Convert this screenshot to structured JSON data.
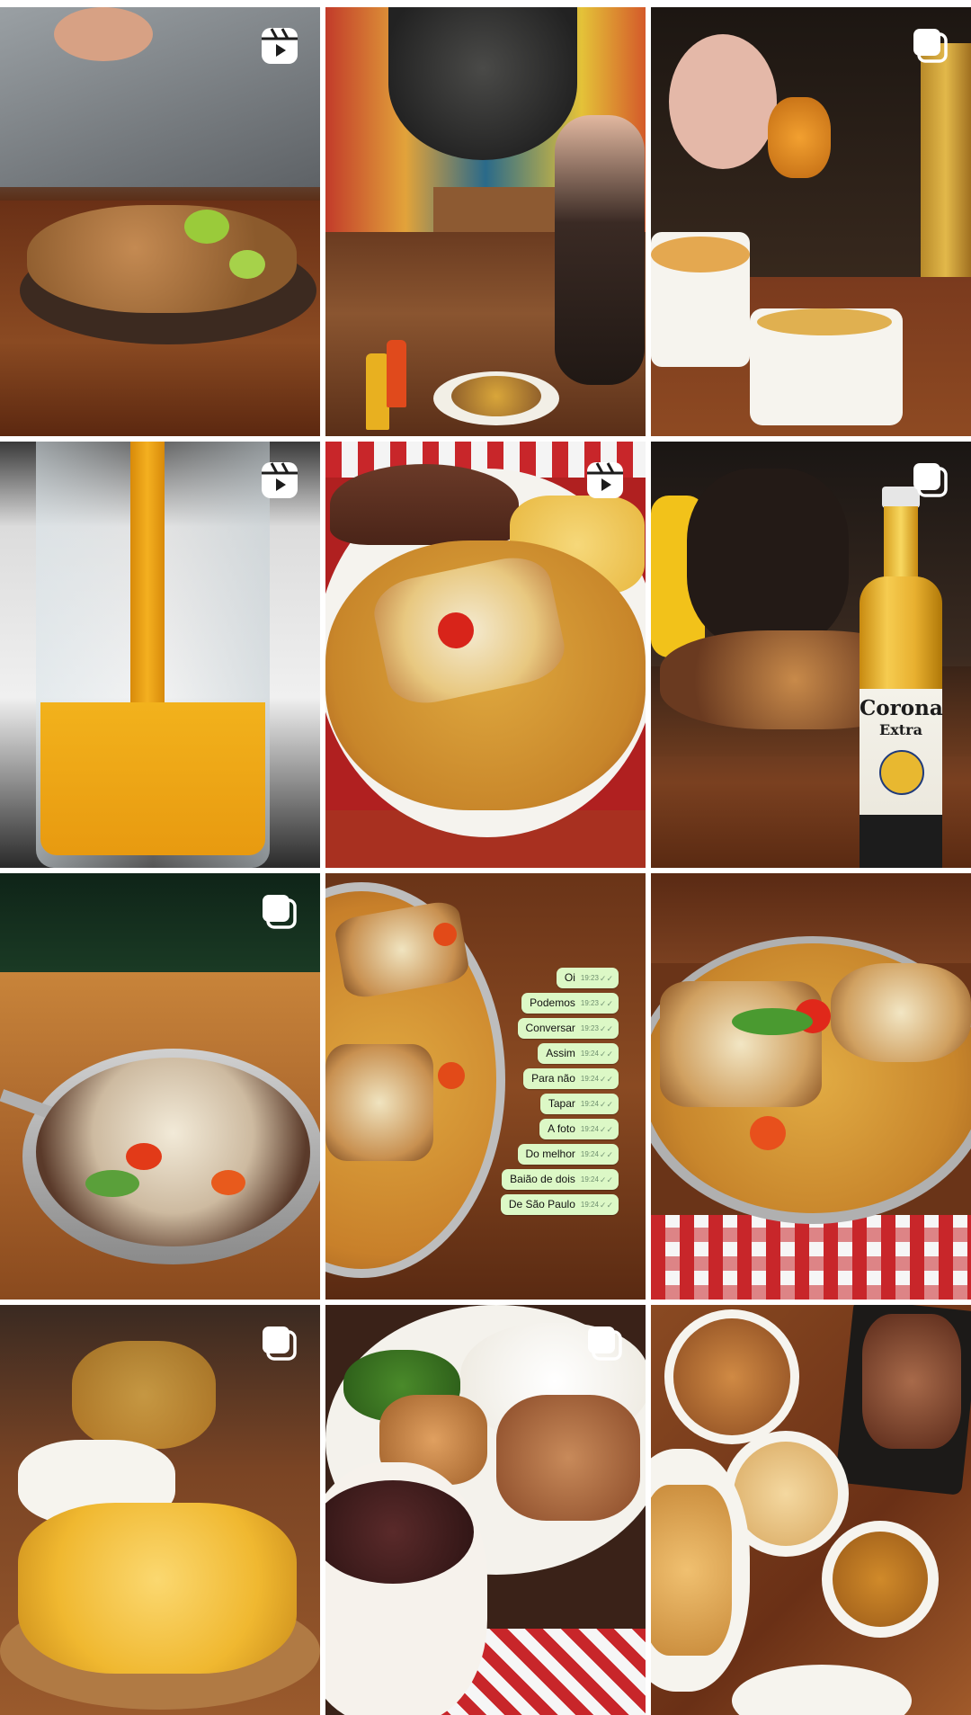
{
  "page": {
    "background": "#ffffff"
  },
  "badges": {
    "reel_icon": "reel-icon",
    "carousel_icon": "carousel-icon"
  },
  "tiles": [
    {
      "id": 1,
      "subject": "pork-crackling-lime-plate",
      "badge": "reel"
    },
    {
      "id": 2,
      "subject": "woman-eating-mural-restaurant",
      "badge": "none"
    },
    {
      "id": 3,
      "subject": "cheese-bites-ramekins-beer",
      "badge": "carousel"
    },
    {
      "id": 4,
      "subject": "juice-pouring-glass",
      "badge": "reel"
    },
    {
      "id": 5,
      "subject": "rice-beans-grilled-cheese-plate",
      "badge": "reel"
    },
    {
      "id": 6,
      "subject": "beer-bottle-table",
      "badge": "carousel"
    },
    {
      "id": 7,
      "subject": "rice-pan-cheese-tomato",
      "badge": "carousel"
    },
    {
      "id": 8,
      "subject": "baiao-de-dois-chat-overlay",
      "badge": "none"
    },
    {
      "id": 9,
      "subject": "baiao-de-dois-red-checkered",
      "badge": "none"
    },
    {
      "id": 10,
      "subject": "fried-cassava-sauce",
      "badge": "carousel"
    },
    {
      "id": 11,
      "subject": "feijoada-rice-plate",
      "badge": "carousel"
    },
    {
      "id": 12,
      "subject": "appetizer-spread-bowls",
      "badge": "none"
    }
  ],
  "beer_label": {
    "brand": "Corona",
    "variant": "Extra"
  },
  "chat_messages": [
    {
      "text": "Oi",
      "time": "19:23"
    },
    {
      "text": "Podemos",
      "time": "19:23"
    },
    {
      "text": "Conversar",
      "time": "19:23"
    },
    {
      "text": "Assim",
      "time": "19:24"
    },
    {
      "text": "Para não",
      "time": "19:24"
    },
    {
      "text": "Tapar",
      "time": "19:24"
    },
    {
      "text": "A foto",
      "time": "19:24"
    },
    {
      "text": "Do melhor",
      "time": "19:24"
    },
    {
      "text": "Baião de dois",
      "time": "19:24"
    },
    {
      "text": "De São Paulo",
      "time": "19:24"
    }
  ],
  "colors": {
    "wood": "#7a3d1d",
    "rice": "#d9a63a",
    "checkered_red": "#c8262a",
    "chat_bubble": "#dcf8c6"
  }
}
